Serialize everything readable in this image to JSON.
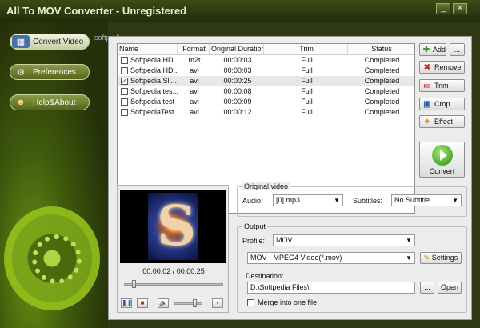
{
  "window": {
    "title": "All To MOV Converter - Unregistered",
    "min_glyph": "_",
    "close_glyph": "×"
  },
  "watermark": "softpedia",
  "nav": [
    {
      "label": "Convert Video",
      "icon": "film-icon",
      "glyph": "▦"
    },
    {
      "label": "Preferences",
      "icon": "gear-icon",
      "glyph": "⚙"
    },
    {
      "label": "Help&About",
      "icon": "users-icon",
      "glyph": "☻"
    }
  ],
  "filelist": {
    "headers": {
      "name": "Name",
      "format": "Format",
      "duration": "Original Duration",
      "trim": "Trim",
      "status": "Status"
    },
    "rows": [
      {
        "name": "Softpedia HD",
        "format": "m2t",
        "duration": "00:00:03",
        "trim": "Full",
        "status": "Completed",
        "checked": false,
        "selected": false
      },
      {
        "name": "Softpedia HD...",
        "format": "avi",
        "duration": "00:00:03",
        "trim": "Full",
        "status": "Completed",
        "checked": false,
        "selected": false
      },
      {
        "name": "Softpedia Sli...",
        "format": "avi",
        "duration": "00:00:25",
        "trim": "Full",
        "status": "Completed",
        "checked": true,
        "selected": true
      },
      {
        "name": "Softpedia tes...",
        "format": "avi",
        "duration": "00:00:08",
        "trim": "Full",
        "status": "Completed",
        "checked": false,
        "selected": false
      },
      {
        "name": "Softpedia test",
        "format": "avi",
        "duration": "00:00:09",
        "trim": "Full",
        "status": "Completed",
        "checked": false,
        "selected": false
      },
      {
        "name": "SoftpediaTest",
        "format": "avi",
        "duration": "00:00:12",
        "trim": "Full",
        "status": "Completed",
        "checked": false,
        "selected": false
      }
    ]
  },
  "actions": {
    "add": "Add",
    "more": "...",
    "remove": "Remove",
    "trim": "Trim",
    "crop": "Crop",
    "effect": "Effect",
    "convert": "Convert"
  },
  "preview": {
    "timecode": "00:00:02 / 00:00:25",
    "progress": 0.08,
    "volume": 0.78
  },
  "original_video": {
    "title": "Original video",
    "audio_label": "Audio:",
    "audio_value": "[0] mp3",
    "subtitles_label": "Subtitles:",
    "subtitles_value": "No Subtitle"
  },
  "output": {
    "title": "Output",
    "profile_label": "Profile:",
    "profile_value": "MOV",
    "format_value": "MOV - MPEG4 Video(*.mov)",
    "settings": "Settings",
    "destination_label": "Destination:",
    "destination_value": "D:\\Softpedia Files\\",
    "browse": "...",
    "open": "Open",
    "merge_label": "Merge into one file",
    "merge_checked": false
  },
  "colors": {
    "accent_green": "#7da819",
    "titlebar": "#2f3a0e"
  }
}
